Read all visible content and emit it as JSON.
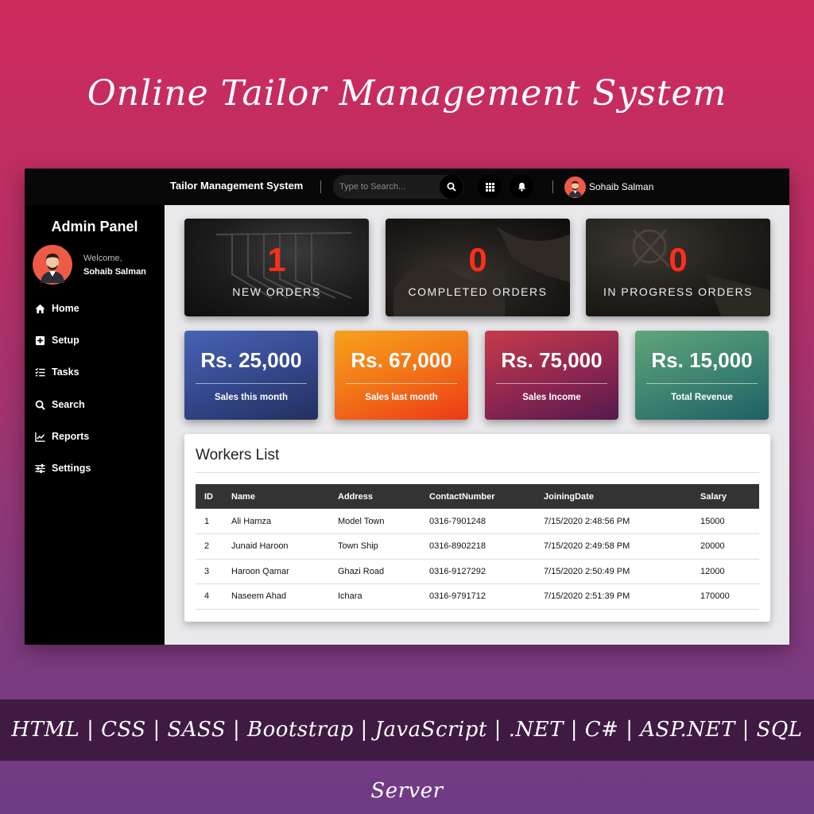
{
  "promo": {
    "title": "Online Tailor Management System",
    "tech_stack": "HTML | CSS | SASS | Bootstrap | JavaScript | .NET | C# | ASP.NET | SQL Server"
  },
  "topbar": {
    "brand": "Tailor Management System",
    "search_placeholder": "Type to Search...",
    "user_name": "Sohaib Salman"
  },
  "sidebar": {
    "title": "Admin Panel",
    "welcome": "Welcome,",
    "user_name": "Sohaib Salman",
    "items": [
      {
        "label": "Home",
        "icon": "home-icon"
      },
      {
        "label": "Setup",
        "icon": "plus-square-icon"
      },
      {
        "label": "Tasks",
        "icon": "tasks-icon"
      },
      {
        "label": "Search",
        "icon": "search-icon"
      },
      {
        "label": "Reports",
        "icon": "chart-line-icon"
      },
      {
        "label": "Settings",
        "icon": "sliders-icon"
      }
    ]
  },
  "order_cards": [
    {
      "value": "1",
      "label": "NEW ORDERS"
    },
    {
      "value": "0",
      "label": "COMPLETED ORDERS"
    },
    {
      "value": "0",
      "label": "IN PROGRESS ORDERS"
    }
  ],
  "sales_cards": [
    {
      "amount": "Rs. 25,000",
      "label": "Sales this month"
    },
    {
      "amount": "Rs. 67,000",
      "label": "Sales last month"
    },
    {
      "amount": "Rs. 75,000",
      "label": "Sales Income"
    },
    {
      "amount": "Rs. 15,000",
      "label": "Total Revenue"
    }
  ],
  "workers": {
    "title": "Workers List",
    "columns": [
      "ID",
      "Name",
      "Address",
      "ContactNumber",
      "JoiningDate",
      "Salary"
    ],
    "rows": [
      [
        "1",
        "Ali Hamza",
        "Model Town",
        "0316-7901248",
        "7/15/2020 2:48:56 PM",
        "15000"
      ],
      [
        "2",
        "Junaid Haroon",
        "Town Ship",
        "0316-8902218",
        "7/15/2020 2:49:58 PM",
        "20000"
      ],
      [
        "3",
        "Haroon Qamar",
        "Ghazi Road",
        "0316-9127292",
        "7/15/2020 2:50:49 PM",
        "12000"
      ],
      [
        "4",
        "Naseem Ahad",
        "Ichara",
        "0316-9791712",
        "7/15/2020 2:51:39 PM",
        "170000"
      ]
    ]
  },
  "colors": {
    "accent_red": "#ff2e1a",
    "topbar_bg": "#080808",
    "sidebar_bg": "#000000",
    "table_header_bg": "#333333"
  }
}
